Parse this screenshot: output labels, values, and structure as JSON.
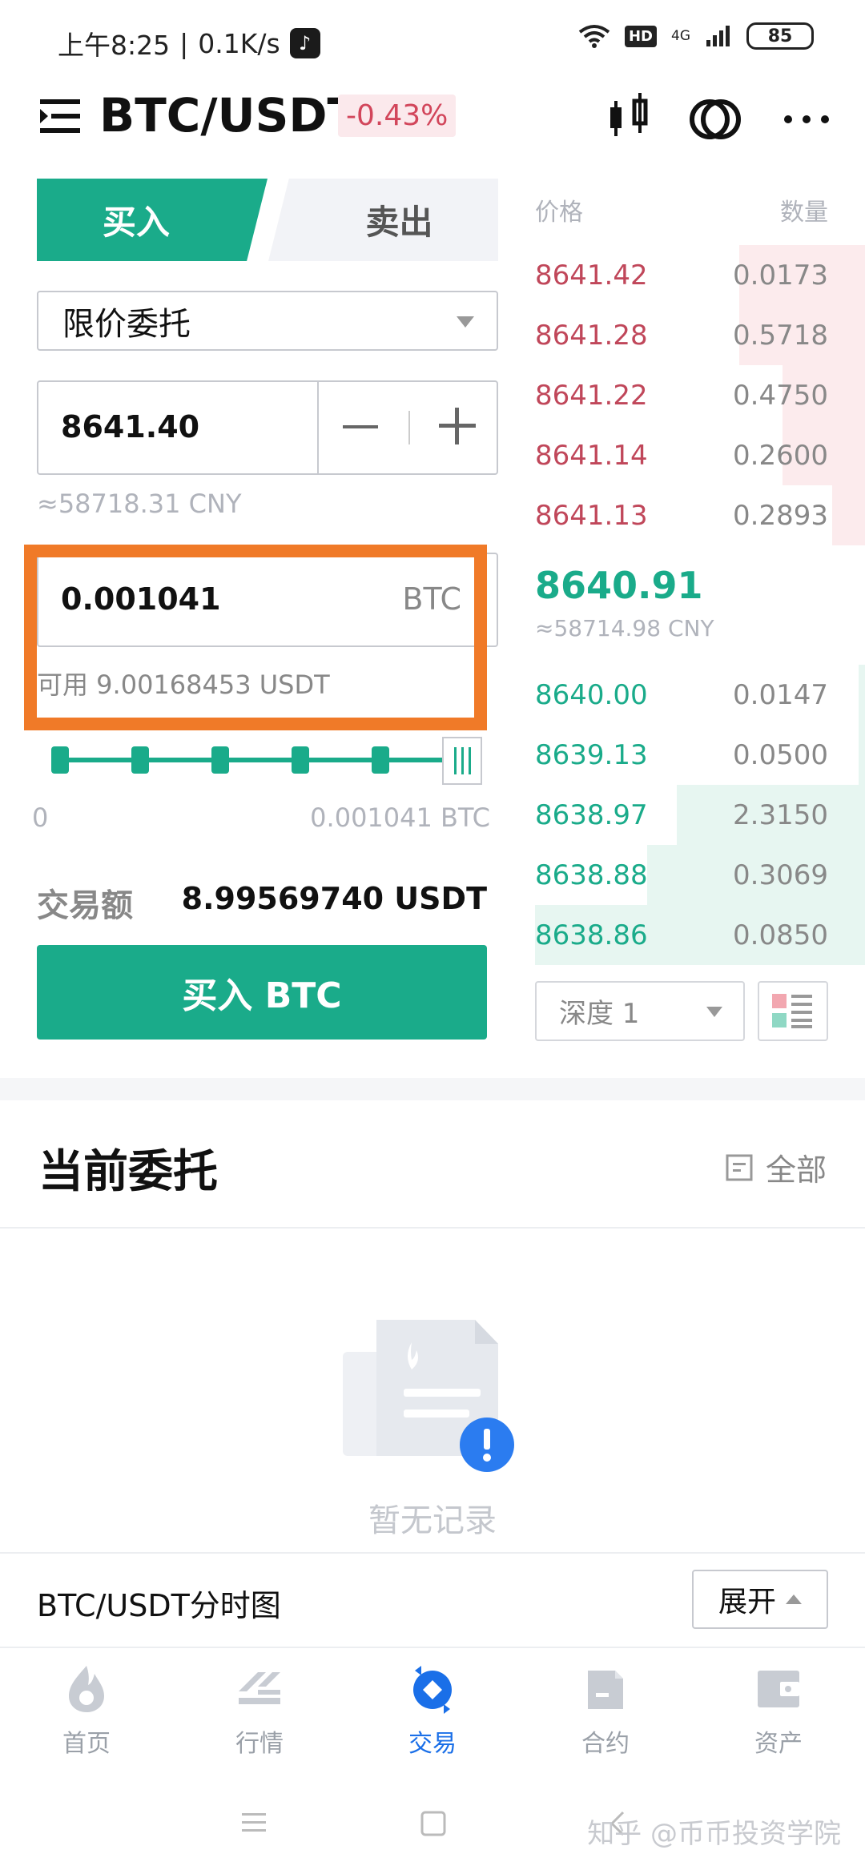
{
  "status_bar": {
    "time": "上午8:25",
    "speed": "0.1K/s",
    "hd": "HD",
    "network": "4G",
    "battery": "85"
  },
  "header": {
    "pair": "BTC/USDT",
    "change": "-0.43%"
  },
  "trade_panel": {
    "buy_tab": "买入",
    "sell_tab": "卖出",
    "order_type": "限价委托",
    "price_value": "8641.40",
    "price_cny": "≈58718.31 CNY",
    "amount_value": "0.001041",
    "amount_unit": "BTC",
    "available": "可用 9.00168453 USDT",
    "range_min": "0",
    "range_max": "0.001041 BTC",
    "trade_amount_label": "交易额",
    "trade_amount_value": "8.99569740 USDT",
    "buy_button": "买入 BTC"
  },
  "order_book": {
    "price_header": "价格",
    "qty_header": "数量",
    "asks": [
      {
        "price": "8641.42",
        "qty": "0.0173",
        "depth": 0.38
      },
      {
        "price": "8641.28",
        "qty": "0.5718",
        "depth": 0.38
      },
      {
        "price": "8641.22",
        "qty": "0.4750",
        "depth": 0.25
      },
      {
        "price": "8641.14",
        "qty": "0.2600",
        "depth": 0.25
      },
      {
        "price": "8641.13",
        "qty": "0.2893",
        "depth": 0.1
      }
    ],
    "mid_price": "8640.91",
    "mid_cny": "≈58714.98 CNY",
    "bids": [
      {
        "price": "8640.00",
        "qty": "0.0147",
        "depth": 0.02
      },
      {
        "price": "8639.13",
        "qty": "0.0500",
        "depth": 0.02
      },
      {
        "price": "8638.97",
        "qty": "2.3150",
        "depth": 0.57
      },
      {
        "price": "8638.88",
        "qty": "0.3069",
        "depth": 0.66
      },
      {
        "price": "8638.86",
        "qty": "0.0850",
        "depth": 1.0
      }
    ],
    "depth_select": "深度 1"
  },
  "orders": {
    "title": "当前委托",
    "all_link": "全部",
    "empty_text": "暂无记录"
  },
  "chart_bar": {
    "title": "BTC/USDT分时图",
    "expand": "展开"
  },
  "bottom_nav": [
    {
      "label": "首页",
      "icon": "flame-icon"
    },
    {
      "label": "行情",
      "icon": "market-icon"
    },
    {
      "label": "交易",
      "icon": "trade-icon"
    },
    {
      "label": "合约",
      "icon": "contract-icon"
    },
    {
      "label": "资产",
      "icon": "wallet-icon"
    }
  ],
  "watermark": "知乎 @币币投资学院",
  "colors": {
    "green": "#1aab8a",
    "red": "#c0475a",
    "highlight": "#f07a28",
    "active_nav": "#1a6fe8"
  }
}
